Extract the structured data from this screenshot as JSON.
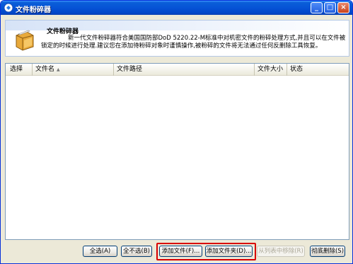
{
  "window": {
    "title": "文件粉碎器",
    "controls": {
      "minimize": "_",
      "maximize": "□",
      "close": "×"
    }
  },
  "header": {
    "title": "文件粉碎器",
    "description": "新一代文件粉碎器符合美国国防部DoD 5220.22-M标准中对机密文件的粉碎处理方式,并且可以在文件被锁定的时候进行处理.建议您在添加待粉碎对象时谨慎操作,被粉碎的文件将无法通过任何反删除工具恢复。"
  },
  "table": {
    "columns": [
      {
        "label": "选择"
      },
      {
        "label": "文件名",
        "sort": "▲"
      },
      {
        "label": "文件路径"
      },
      {
        "label": "文件大小"
      },
      {
        "label": "状态"
      }
    ],
    "rows": []
  },
  "buttons": {
    "select_all": "全选(A)",
    "select_none": "全不选(B)",
    "add_file": "添加文件(F)...",
    "add_folder": "添加文件夹(D)...",
    "remove_from_list": "从列表中移除(R)",
    "shred": "彻底删除(S)"
  },
  "colors": {
    "titlebar": "#0653d6",
    "highlight": "#d80000"
  }
}
